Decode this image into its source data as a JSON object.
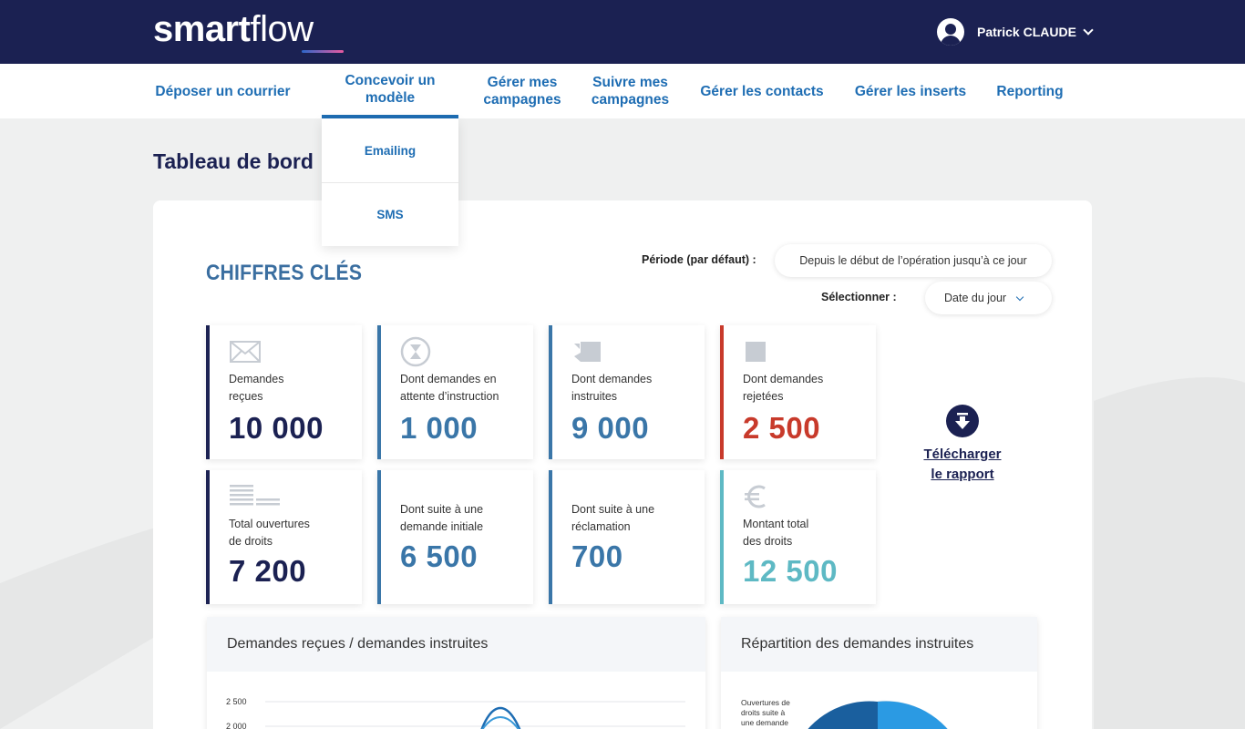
{
  "header": {
    "logo_bold": "smart",
    "logo_light": "flow",
    "user_name": "Patrick CLAUDE"
  },
  "nav": {
    "items": [
      {
        "label": "Déposer un courrier"
      },
      {
        "label": "Concevoir un modèle"
      },
      {
        "label": "Gérer mes campagnes"
      },
      {
        "label": "Suivre mes campagnes"
      },
      {
        "label": "Gérer les contacts"
      },
      {
        "label": "Gérer les inserts"
      },
      {
        "label": "Reporting"
      }
    ],
    "dropdown": [
      "Emailing",
      "SMS"
    ]
  },
  "page": {
    "title": "Tableau de bord"
  },
  "key_figures": {
    "title": "CHIFFRES CLÉS",
    "period_label": "Période (par défaut) :",
    "period_value": "Depuis le début de l’opération jusqu’à ce jour",
    "select_label": "Sélectionner :",
    "select_value": "Date du jour"
  },
  "kpis": [
    {
      "label": "Demandes\nreçues",
      "value": "10 000",
      "color": "#1b2152",
      "border": "#1b2152",
      "icon": "envelope-icon"
    },
    {
      "label": "Dont demandes en\nattente d’instruction",
      "value": "1 000",
      "color": "#3a76a8",
      "border": "#3a76a8",
      "icon": "hourglass-icon"
    },
    {
      "label": "Dont demandes\ninstruites",
      "value": "9 000",
      "color": "#3a76a8",
      "border": "#3a76a8",
      "icon": "checked-folder-icon"
    },
    {
      "label": "Dont demandes\nrejetées",
      "value": "2 500",
      "color": "#c83a2b",
      "border": "#c83a2b",
      "icon": "rejected-icon"
    },
    {
      "label": "Total ouvertures\nde droits",
      "value": "7 200",
      "color": "#1b2152",
      "border": "#1b2152",
      "icon": "document-lines-icon"
    },
    {
      "label": "Dont suite à une\ndemande initiale",
      "value": "6 500",
      "color": "#3a76a8",
      "border": "#3a76a8",
      "icon": ""
    },
    {
      "label": "Dont suite à une\nréclamation",
      "value": "700",
      "color": "#3a76a8",
      "border": "#3a76a8",
      "icon": ""
    },
    {
      "label": "Montant total\ndes droits",
      "value": "12 500",
      "color": "#5eb9c4",
      "border": "#5eb9c4",
      "icon": "euro-icon"
    }
  ],
  "download": {
    "line1": "Télécharger",
    "line2": "le rapport"
  },
  "panels": {
    "left_title": "Demandes reçues / demandes instruites",
    "right_title": "Répartition des demandes instruites",
    "pie_label_line1": "Ouvertures de",
    "pie_label_line2": "droits suite à",
    "pie_label_line3": "une demande"
  },
  "chart_data": {
    "type": "line",
    "yticks": [
      "2 500",
      "2 000"
    ],
    "ylim_visible": [
      2000,
      2500
    ]
  }
}
